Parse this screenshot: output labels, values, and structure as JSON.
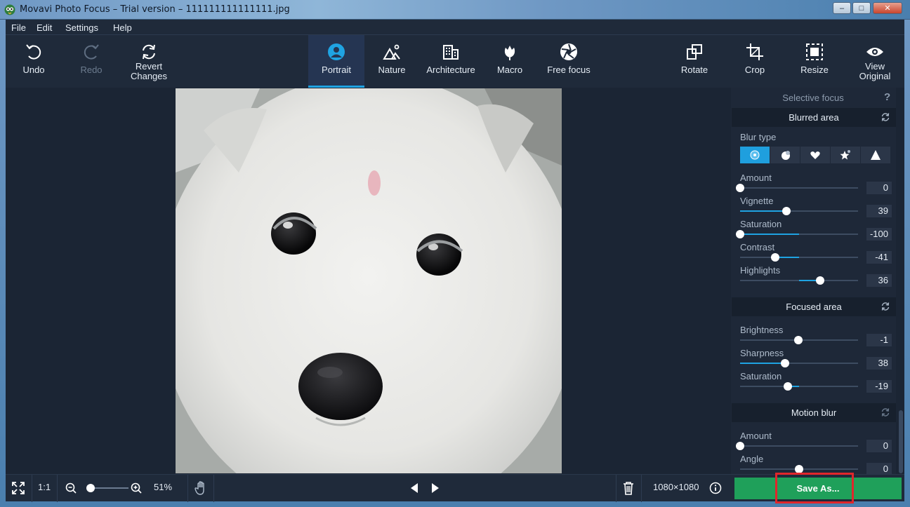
{
  "window": {
    "title": "Movavi Photo Focus – Trial version – 111111111111111.jpg",
    "minimize": "–",
    "maximize": "□",
    "close": "✕"
  },
  "menu": [
    "File",
    "Edit",
    "Settings",
    "Help"
  ],
  "toolbar": {
    "undo": "Undo",
    "redo": "Redo",
    "revert_line1": "Revert",
    "revert_line2": "Changes",
    "portrait": "Portrait",
    "nature": "Nature",
    "architecture": "Architecture",
    "macro": "Macro",
    "free_focus": "Free focus",
    "rotate": "Rotate",
    "crop": "Crop",
    "resize": "Resize",
    "view_line1": "View",
    "view_line2": "Original",
    "active_tab": "Portrait"
  },
  "panel": {
    "selective_focus": "Selective focus",
    "help": "?",
    "blurred_area": {
      "title": "Blurred area",
      "blur_type_label": "Blur type",
      "blur_types": [
        "circle-blur-icon",
        "bokeh-dot-icon",
        "heart-icon",
        "star-icon",
        "triangle-icon"
      ],
      "selected_blur_type": 0,
      "controls": [
        {
          "label": "Amount",
          "value": "0",
          "min": 0,
          "max": 100,
          "num": 0,
          "signed": false
        },
        {
          "label": "Vignette",
          "value": "39",
          "min": 0,
          "max": 100,
          "num": 39,
          "signed": false
        },
        {
          "label": "Saturation",
          "value": "-100",
          "min": -100,
          "max": 100,
          "num": -100,
          "signed": true
        },
        {
          "label": "Contrast",
          "value": "-41",
          "min": -100,
          "max": 100,
          "num": -41,
          "signed": true
        },
        {
          "label": "Highlights",
          "value": "36",
          "min": -100,
          "max": 100,
          "num": 36,
          "signed": true
        }
      ]
    },
    "focused_area": {
      "title": "Focused area",
      "controls": [
        {
          "label": "Brightness",
          "value": "-1",
          "min": -100,
          "max": 100,
          "num": -1,
          "signed": true
        },
        {
          "label": "Sharpness",
          "value": "38",
          "min": 0,
          "max": 100,
          "num": 38,
          "signed": false
        },
        {
          "label": "Saturation",
          "value": "-19",
          "min": -100,
          "max": 100,
          "num": -19,
          "signed": true
        }
      ]
    },
    "motion_blur": {
      "title": "Motion blur",
      "controls": [
        {
          "label": "Amount",
          "value": "0",
          "min": 0,
          "max": 100,
          "num": 0,
          "signed": false
        },
        {
          "label": "Angle",
          "value": "0",
          "min": -180,
          "max": 180,
          "num": 0,
          "signed": true
        }
      ]
    }
  },
  "bottom": {
    "one_to_one": "1:1",
    "zoom_percent": "51%",
    "zoom_fraction": 0.1,
    "dimensions": "1080×1080",
    "save_as": "Save As..."
  },
  "colors": {
    "accent": "#1fa3e2",
    "save_green": "#1fa05a",
    "highlight_red": "#e0262b"
  }
}
